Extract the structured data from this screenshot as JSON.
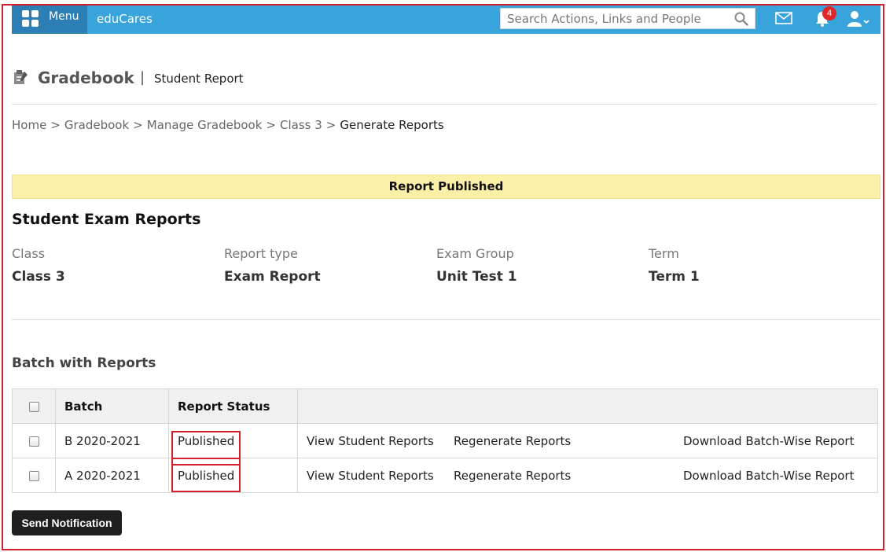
{
  "topbar": {
    "menu_label": "Menu",
    "brand": "eduCares",
    "search_placeholder": "Search Actions, Links and People",
    "notification_count": "4"
  },
  "header": {
    "title": "Gradebook",
    "separator": "|",
    "subtitle": "Student Report"
  },
  "breadcrumb": [
    "Home",
    "Gradebook",
    "Manage Gradebook",
    "Class 3",
    "Generate Reports"
  ],
  "alert": "Report Published",
  "section_title": "Student Exam Reports",
  "info": [
    {
      "label": "Class",
      "value": "Class 3"
    },
    {
      "label": "Report type",
      "value": "Exam Report"
    },
    {
      "label": "Exam Group",
      "value": "Unit Test 1"
    },
    {
      "label": "Term",
      "value": "Term 1"
    }
  ],
  "batch_title": "Batch with Reports",
  "table": {
    "headers": [
      "Batch",
      "Report Status"
    ],
    "rows": [
      {
        "batch": "B 2020-2021",
        "status": "Published",
        "view": "View Student Reports",
        "regen": "Regenerate Reports",
        "download": "Download Batch-Wise Report"
      },
      {
        "batch": "A 2020-2021",
        "status": "Published",
        "view": "View Student Reports",
        "regen": "Regenerate Reports",
        "download": "Download Batch-Wise Report"
      }
    ]
  },
  "send_button": "Send Notification",
  "colors": {
    "topbar": "#39a3dc",
    "menu_bg": "#2c7fb5",
    "alert_bg": "#fcefa8",
    "highlight": "#d0202a",
    "badge": "#e3262b",
    "button_bg": "#1f1f1f"
  },
  "icons": [
    "menu-grid-icon",
    "search-icon",
    "mail-icon",
    "bell-icon",
    "user-icon",
    "gradebook-icon"
  ]
}
